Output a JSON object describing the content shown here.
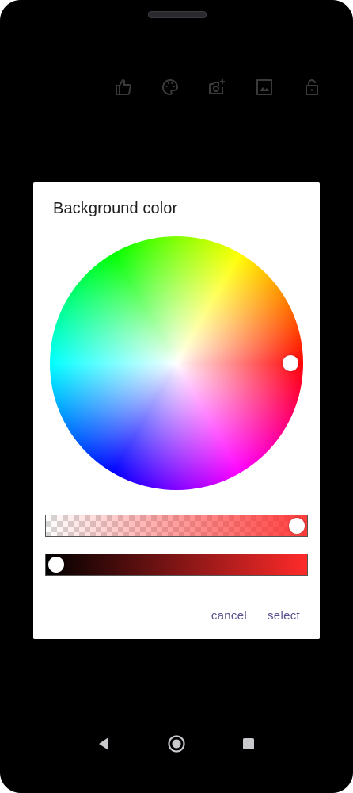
{
  "toolbar": {
    "items": [
      {
        "name": "like-icon"
      },
      {
        "name": "palette-icon"
      },
      {
        "name": "add-photo-icon"
      },
      {
        "name": "image-icon"
      },
      {
        "name": "lock-open-icon"
      }
    ],
    "icon_color": "#3a3a3a"
  },
  "dialog": {
    "title": "Background color",
    "cancel_label": "cancel",
    "select_label": "select",
    "selected_color": "#ff2a2a",
    "hue_degrees": 0,
    "saturation": 0.9,
    "alpha": 1.0,
    "value": 0.0
  },
  "navbar": {
    "items": [
      {
        "name": "back-icon"
      },
      {
        "name": "home-icon"
      },
      {
        "name": "recents-icon"
      }
    ]
  },
  "colors": {
    "action_text": "#5a4f8c",
    "screen_bg": "#000000",
    "dialog_bg": "#ffffff"
  }
}
